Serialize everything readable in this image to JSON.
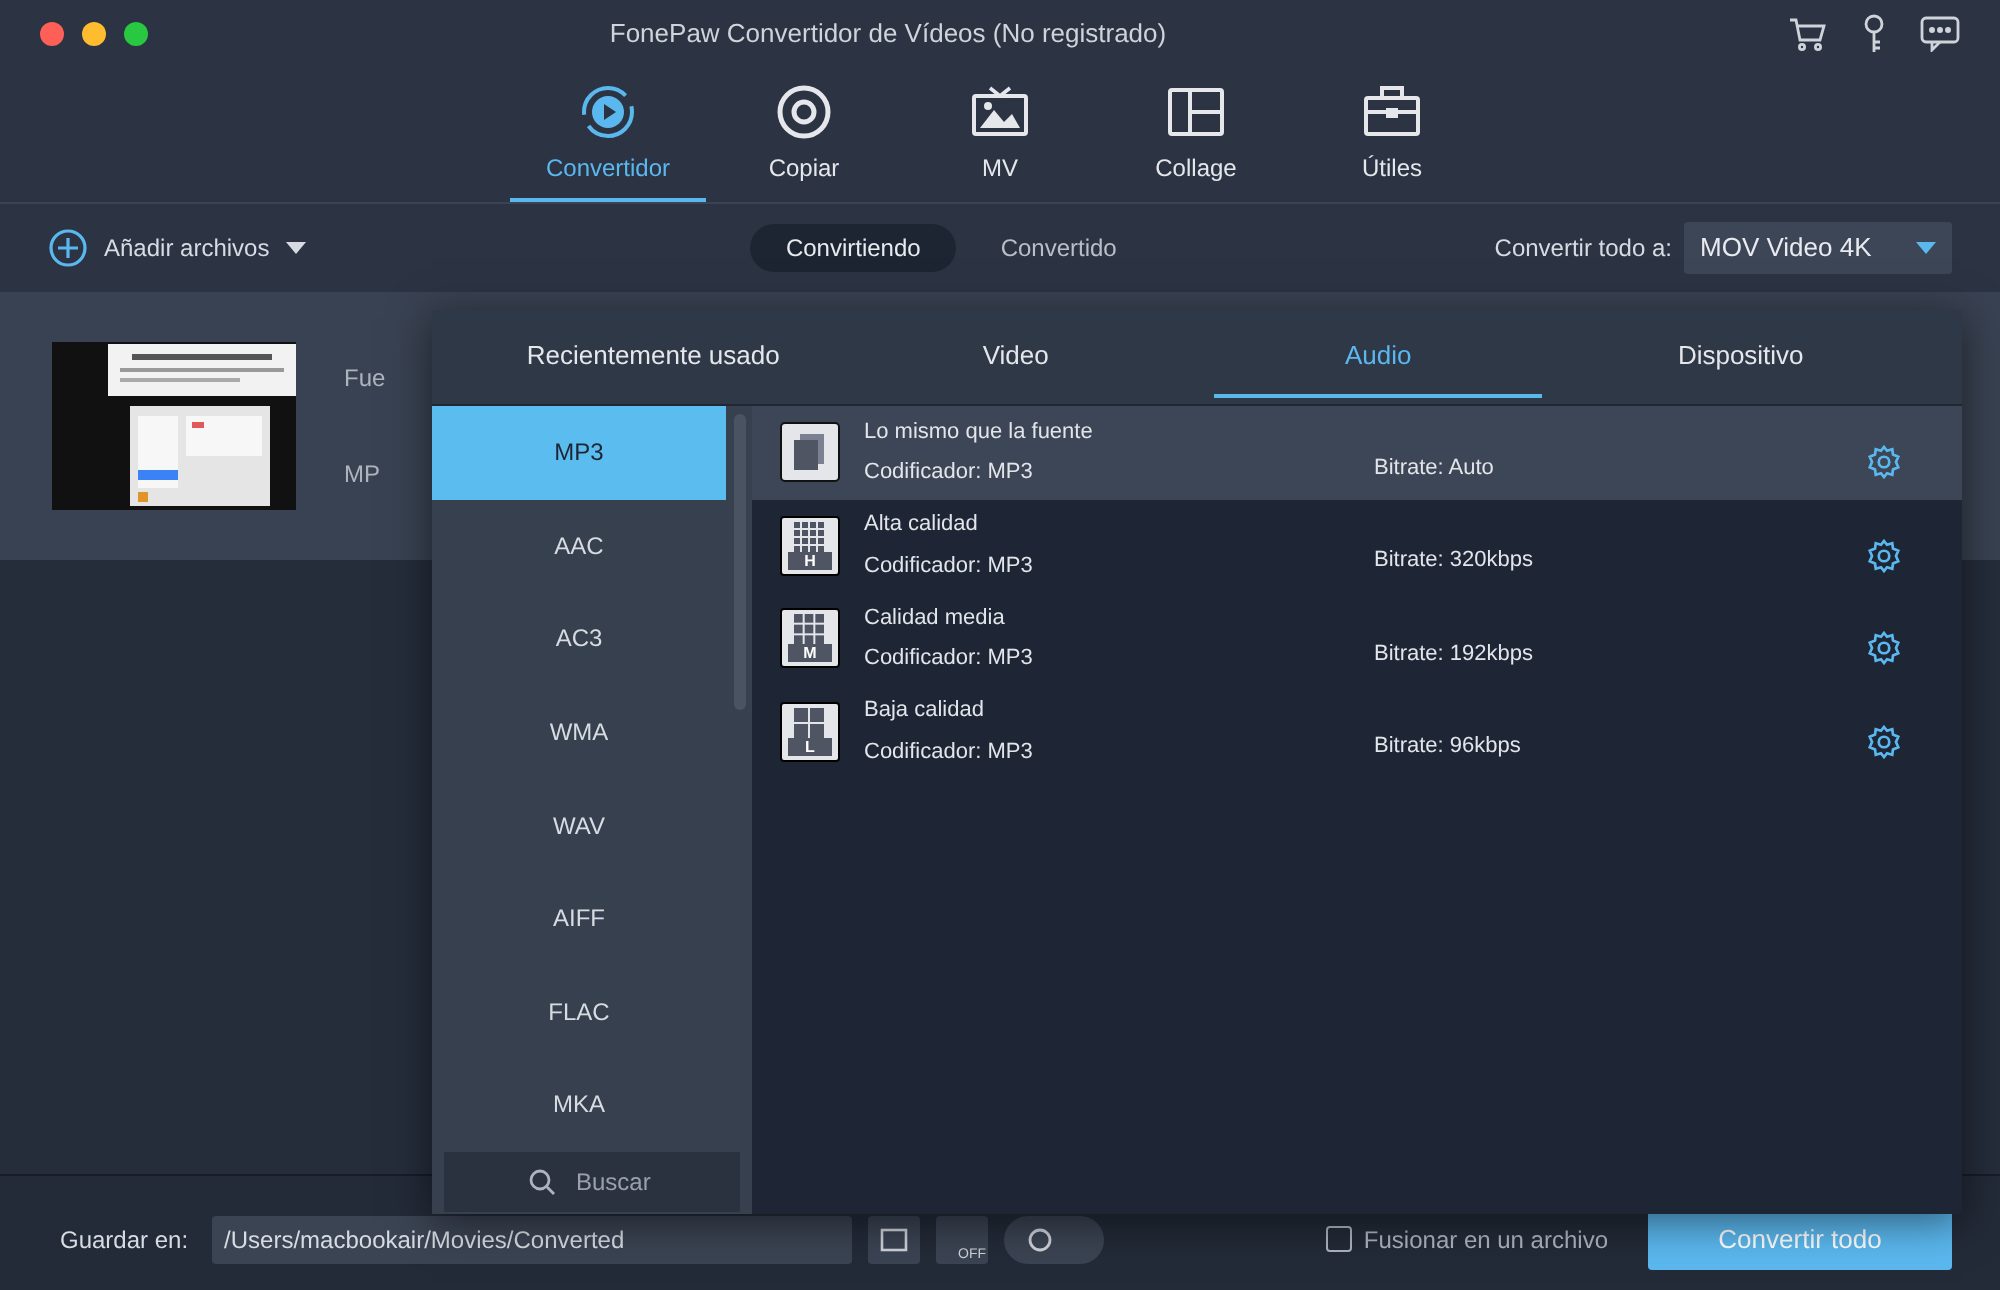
{
  "window": {
    "title": "FonePaw Convertidor de Vídeos (No registrado)"
  },
  "nav_tabs": [
    {
      "label": "Convertidor",
      "selected": true,
      "kind": "convert"
    },
    {
      "label": "Copiar",
      "selected": false,
      "kind": "disc"
    },
    {
      "label": "MV",
      "selected": false,
      "kind": "tv"
    },
    {
      "label": "Collage",
      "selected": false,
      "kind": "collage"
    },
    {
      "label": "Útiles",
      "selected": false,
      "kind": "toolbox"
    }
  ],
  "toolbar": {
    "add_files": "Añadir archivos",
    "segments": [
      {
        "label": "Convirtiendo",
        "selected": true
      },
      {
        "label": "Convertido",
        "selected": false
      }
    ],
    "convert_all_label": "Convertir todo a:",
    "convert_all_value": "MOV Video 4K"
  },
  "file": {
    "source_label": "Fue",
    "format_label": "MP"
  },
  "format_popup": {
    "tabs": [
      {
        "label": "Recientemente usado",
        "selected": false
      },
      {
        "label": "Video",
        "selected": false
      },
      {
        "label": "Audio",
        "selected": true
      },
      {
        "label": "Dispositivo",
        "selected": false
      }
    ],
    "formats": [
      {
        "label": "MP3",
        "selected": true
      },
      {
        "label": "AAC",
        "selected": false
      },
      {
        "label": "AC3",
        "selected": false
      },
      {
        "label": "WMA",
        "selected": false
      },
      {
        "label": "WAV",
        "selected": false
      },
      {
        "label": "AIFF",
        "selected": false
      },
      {
        "label": "FLAC",
        "selected": false
      },
      {
        "label": "MKA",
        "selected": false
      }
    ],
    "search_placeholder": "Buscar",
    "presets": [
      {
        "kind": "source",
        "name": "Lo mismo que la fuente",
        "encoder": "Codificador: MP3",
        "bitrate": "Bitrate: Auto",
        "selected": true
      },
      {
        "kind": "quality",
        "badge": "H",
        "name": "Alta calidad",
        "encoder": "Codificador: MP3",
        "bitrate": "Bitrate: 320kbps",
        "selected": false
      },
      {
        "kind": "quality",
        "badge": "M",
        "name": "Calidad media",
        "encoder": "Codificador: MP3",
        "bitrate": "Bitrate: 192kbps",
        "selected": false
      },
      {
        "kind": "quality",
        "badge": "L",
        "name": "Baja calidad",
        "encoder": "Codificador: MP3",
        "bitrate": "Bitrate: 96kbps",
        "selected": false
      }
    ]
  },
  "bottom_bar": {
    "save_label": "Guardar en:",
    "path": "/Users/macbookair/Movies/Converted",
    "gpu_label": "OFF",
    "merge_label": "Fusionar en un archivo",
    "merge_checked": false,
    "convert_button": "Convertir todo"
  }
}
